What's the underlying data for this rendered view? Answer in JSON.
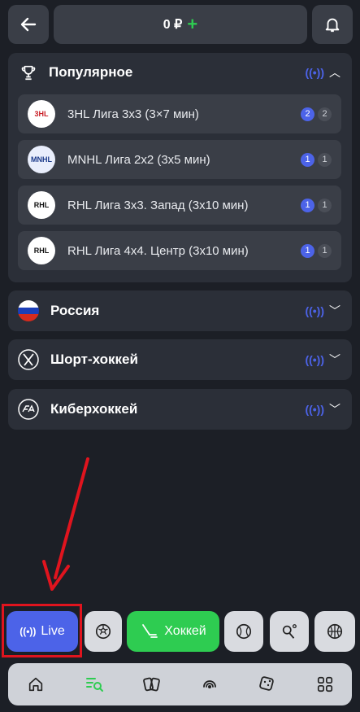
{
  "header": {
    "balance_amount": "0 ₽",
    "add_symbol": "+"
  },
  "popular": {
    "title": "Популярное",
    "items": [
      {
        "name": "3HL Лига 3x3 (3×7 мин)",
        "logo": "3HL",
        "count_live": "2",
        "count_total": "2"
      },
      {
        "name": "MNHL Лига 2x2 (3x5 мин)",
        "logo": "MNHL",
        "count_live": "1",
        "count_total": "1"
      },
      {
        "name": "RHL Лига 3x3. Запад (3x10 мин)",
        "logo": "RHL",
        "count_live": "1",
        "count_total": "1"
      },
      {
        "name": "RHL Лига 4x4. Центр (3x10 мин)",
        "logo": "RHL",
        "count_live": "1",
        "count_total": "1"
      }
    ]
  },
  "sections": [
    {
      "title": "Россия"
    },
    {
      "title": "Шорт-хоккей"
    },
    {
      "title": "Киберхоккей"
    }
  ],
  "sport_bar": {
    "live_label": "Live",
    "hockey_label": "Хоккей"
  },
  "colors": {
    "accent_blue": "#4c63e8",
    "accent_green": "#2ecc51",
    "highlight_red": "#e0141e"
  }
}
